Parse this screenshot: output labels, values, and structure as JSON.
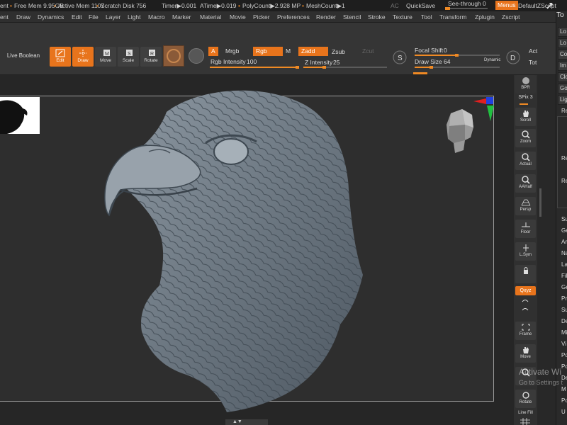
{
  "statusbar": {
    "items": [
      "ent",
      "Free Mem 9.95GB",
      "Active Mem 1107",
      "Scratch Disk 756",
      "Timer▶0.001",
      "ATime▶0.019",
      "PolyCount▶2.928 MP",
      "MeshCount▶1"
    ],
    "ac": "AC",
    "quicksave": "QuickSave",
    "see_through": "See-through",
    "see_through_value": "0",
    "see_through_level": 0,
    "menus": "Menus",
    "default_script": "DefaultZScript"
  },
  "menubar": {
    "items": [
      "ent",
      "Draw",
      "Dynamics",
      "Edit",
      "File",
      "Layer",
      "Light",
      "Macro",
      "Marker",
      "Material",
      "Movie",
      "Picker",
      "Preferences",
      "Render",
      "Stencil",
      "Stroke",
      "Texture",
      "Tool",
      "Transform",
      "Zplugin",
      "Zscript"
    ]
  },
  "toolbar": {
    "live_boolean": "Live Boolean",
    "edit": "Edit",
    "draw": "Draw",
    "move": "Move",
    "scale": "Scale",
    "rotate": "Rotate",
    "a": "A",
    "mrgb": "Mrgb",
    "rgb": "Rgb",
    "m": "M",
    "zadd": "Zadd",
    "zsub": "Zsub",
    "zcut": "Zcut",
    "rgb_intensity_label": "Rgb Intensity",
    "rgb_intensity": "100",
    "rgb_intensity_level": 1.0,
    "z_intensity_label": "Z Intensity",
    "z_intensity": "25",
    "z_intensity_level": 0.25,
    "focal_shift_label": "Focal Shift",
    "focal_shift": "0",
    "focal_shift_level": 0.5,
    "draw_size_label": "Draw Size",
    "draw_size": "64",
    "draw_size_level": 0.2,
    "dynamic": "Dynamic",
    "s_label": "S",
    "d_label": "D",
    "act": "Act",
    "tot": "Tot"
  },
  "shelf": {
    "bpr": "BPR",
    "spix_label": "SPix",
    "spix_value": "3",
    "buttons": [
      "Scroll",
      "Zoom",
      "Actual",
      "AAHalf",
      "Persp",
      "Floor",
      "L.Sym",
      "",
      "Frame",
      "Move",
      "",
      "Rotate"
    ],
    "qxyz": "Qxyz",
    "line_fill": "Line Fill"
  },
  "palette": {
    "title": "To",
    "buttons": [
      "Lo",
      "Lo",
      "Co",
      "Im",
      "Clo",
      "Go",
      "Lig"
    ],
    "sub_items": [
      "Re",
      "Re",
      "Re"
    ],
    "items": [
      "Su",
      "Ge",
      "Ar",
      "Na",
      "La",
      "Fil",
      "Ge",
      "Pr",
      "Su",
      "De",
      "Mi",
      "Vi",
      "Po",
      "Po",
      "De",
      "M",
      "Po",
      "U",
      "Te",
      "D"
    ]
  },
  "watermark": {
    "line1": "Activate Wi",
    "line2": "Go to Settings t"
  },
  "colors": {
    "accent": "#e8741c",
    "background": "#262626",
    "panel": "#353535"
  }
}
